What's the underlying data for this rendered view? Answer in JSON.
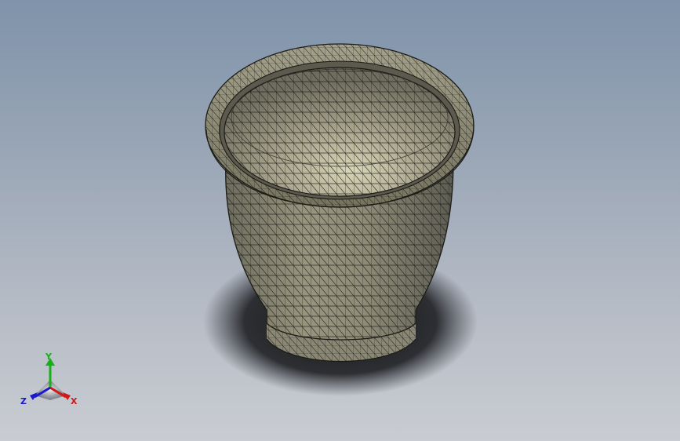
{
  "viewport": {
    "background_top": "#7f93aa",
    "background_bottom": "#c9ccd2",
    "model_fill": "#8c8a77",
    "mesh_edge_color": "#1c1c16",
    "shadow_color": "#1e1f22"
  },
  "triad": {
    "x_label": "X",
    "y_label": "Y",
    "z_label": "Z",
    "x_color": "#d01818",
    "y_color": "#18b018",
    "z_color": "#1818d0"
  }
}
